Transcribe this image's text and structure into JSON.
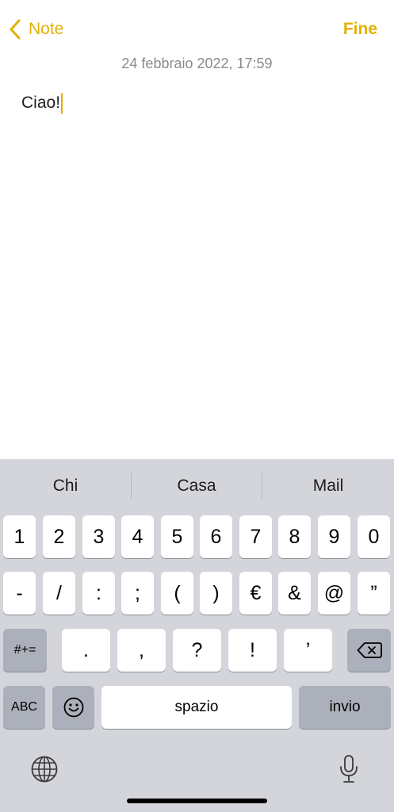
{
  "nav": {
    "back_label": "Note",
    "done_label": "Fine"
  },
  "note": {
    "date": "24 febbraio 2022, 17:59",
    "text": "Ciao!"
  },
  "suggestions": [
    "Chi",
    "Casa",
    "Mail"
  ],
  "keyboard": {
    "row1": [
      "1",
      "2",
      "3",
      "4",
      "5",
      "6",
      "7",
      "8",
      "9",
      "0"
    ],
    "row2": [
      "-",
      "/",
      ":",
      ";",
      "(",
      ")",
      "€",
      "&",
      "@",
      "”"
    ],
    "row3_mode": "#+=",
    "row3": [
      ".",
      ",",
      "?",
      "!",
      "’"
    ],
    "abc_label": "ABC",
    "space_label": "spazio",
    "return_label": "invio"
  },
  "icons": {
    "back": "chevron-left-icon",
    "delete": "backspace-icon",
    "emoji": "emoji-icon",
    "globe": "globe-icon",
    "mic": "microphone-icon"
  },
  "colors": {
    "accent": "#E3B007",
    "keyboard_bg": "#D3D5DB",
    "dark_key": "#ABB0BA"
  }
}
